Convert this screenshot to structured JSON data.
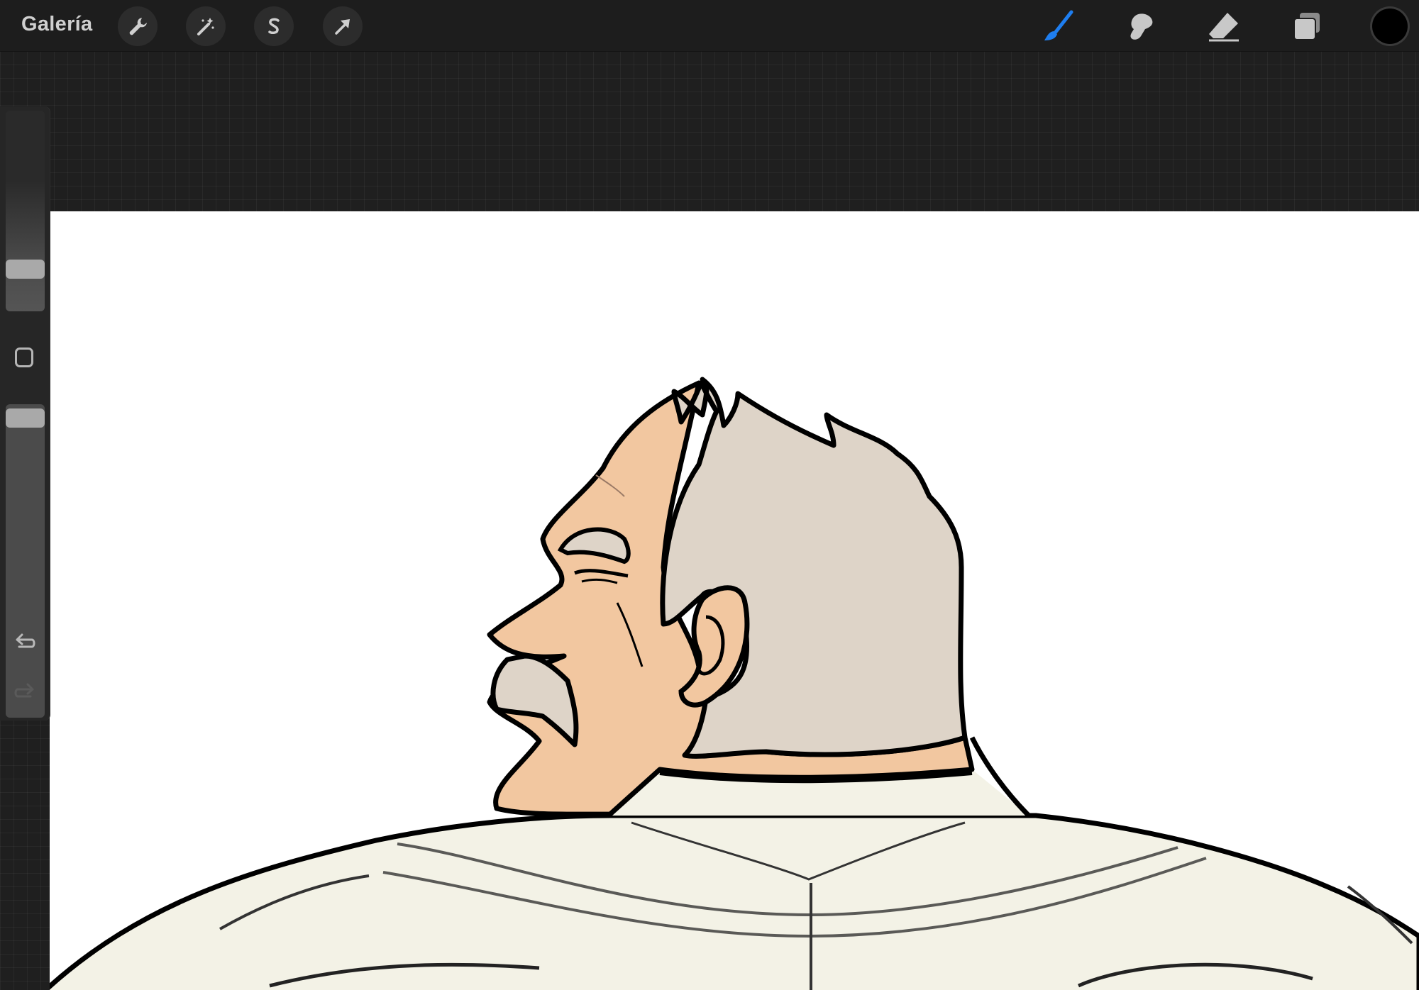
{
  "topbar": {
    "gallery_label": "Galería",
    "left_tools": [
      {
        "icon": "wrench-icon",
        "name": "actions"
      },
      {
        "icon": "magic-wand-icon",
        "name": "adjustments"
      },
      {
        "icon": "selection-s-icon",
        "name": "selection"
      },
      {
        "icon": "arrow-cursor-icon",
        "name": "transform"
      }
    ],
    "right_tools": [
      {
        "icon": "brush-icon",
        "name": "paint",
        "active": true
      },
      {
        "icon": "smudge-icon",
        "name": "smudge"
      },
      {
        "icon": "eraser-icon",
        "name": "erase"
      },
      {
        "icon": "layers-icon",
        "name": "layers"
      }
    ],
    "current_color": "#000000"
  },
  "sidebar": {
    "brush_size_level": 0.82,
    "opacity_level": 0.0,
    "icons": [
      "modify-square-icon",
      "undo-icon",
      "redo-icon"
    ]
  },
  "colors": {
    "accent": "#1e7ef0",
    "skin": "#f2c7a0",
    "hair": "#ded4c8",
    "suit": "#f3f2e6",
    "outline": "#000000"
  }
}
